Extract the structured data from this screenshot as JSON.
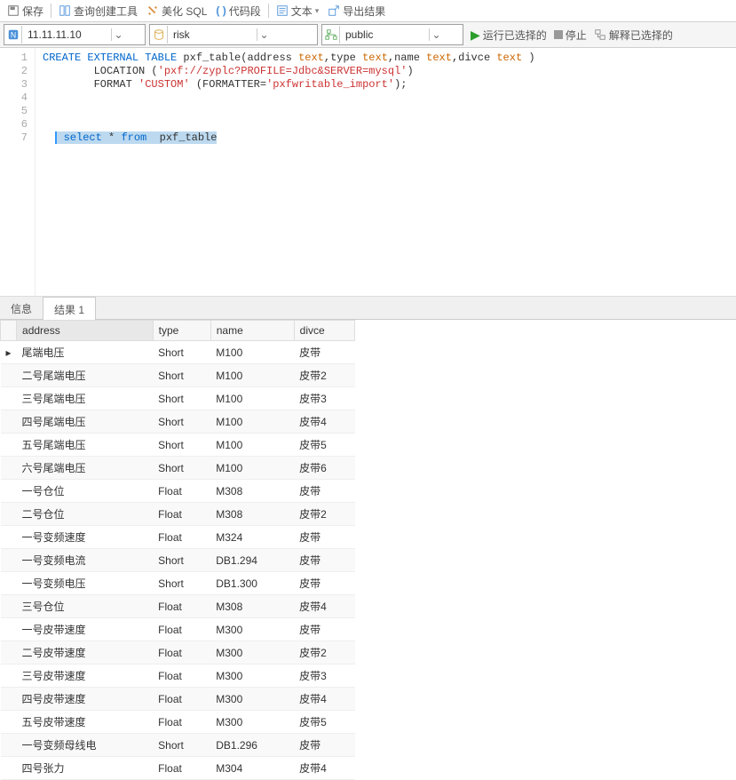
{
  "toolbar1": {
    "save": "保存",
    "queryBuilder": "查询创建工具",
    "beautifySql": "美化 SQL",
    "codeSnippet": "代码段",
    "text": "文本",
    "exportResult": "导出结果"
  },
  "toolbar2": {
    "host": "11.11.11.10",
    "database": "risk",
    "schema": "public",
    "run": "运行已选择的",
    "stop": "停止",
    "explain": "解释已选择的"
  },
  "editor": {
    "lines": [
      "1",
      "2",
      "3",
      "4",
      "5",
      "6",
      "7"
    ]
  },
  "sql": {
    "l1a": "CREATE EXTERNAL TABLE",
    "l1b": " pxf_table(address ",
    "l1c": "text",
    "l1d": ",type ",
    "l1e": "text",
    "l1f": ",name ",
    "l1g": "text",
    "l1h": ",divce ",
    "l1i": "text",
    "l1j": " )",
    "l2a": "        LOCATION (",
    "l2b": "'pxf://zyplc?PROFILE=Jdbc&SERVER=mysql'",
    "l2c": ")",
    "l3a": "        FORMAT ",
    "l3b": "'CUSTOM'",
    "l3c": " (FORMATTER=",
    "l3d": "'pxfwritable_import'",
    "l3e": ");",
    "l7a": " select",
    "l7b": " * ",
    "l7c": "from",
    "l7d": "  pxf_table"
  },
  "tabs": {
    "info": "信息",
    "result1": "结果 1"
  },
  "cols": {
    "c1": "address",
    "c2": "type",
    "c3": "name",
    "c4": "divce"
  },
  "rows": [
    {
      "address": "尾端电压",
      "type": "Short",
      "name": "M100",
      "divce": "皮带"
    },
    {
      "address": "二号尾端电压",
      "type": "Short",
      "name": "M100",
      "divce": "皮带2"
    },
    {
      "address": "三号尾端电压",
      "type": "Short",
      "name": "M100",
      "divce": "皮带3"
    },
    {
      "address": "四号尾端电压",
      "type": "Short",
      "name": "M100",
      "divce": "皮带4"
    },
    {
      "address": "五号尾端电压",
      "type": "Short",
      "name": "M100",
      "divce": "皮带5"
    },
    {
      "address": "六号尾端电压",
      "type": "Short",
      "name": "M100",
      "divce": "皮带6"
    },
    {
      "address": "一号仓位",
      "type": "Float",
      "name": "M308",
      "divce": "皮带"
    },
    {
      "address": "二号仓位",
      "type": "Float",
      "name": "M308",
      "divce": "皮带2"
    },
    {
      "address": "一号变频速度",
      "type": "Float",
      "name": "M324",
      "divce": "皮带"
    },
    {
      "address": "一号变频电流",
      "type": "Short",
      "name": "DB1.294",
      "divce": "皮带"
    },
    {
      "address": "一号变频电压",
      "type": "Short",
      "name": "DB1.300",
      "divce": "皮带"
    },
    {
      "address": "三号仓位",
      "type": "Float",
      "name": "M308",
      "divce": "皮带4"
    },
    {
      "address": "一号皮带速度",
      "type": "Float",
      "name": "M300",
      "divce": "皮带"
    },
    {
      "address": "二号皮带速度",
      "type": "Float",
      "name": "M300",
      "divce": "皮带2"
    },
    {
      "address": "三号皮带速度",
      "type": "Float",
      "name": "M300",
      "divce": "皮带3"
    },
    {
      "address": "四号皮带速度",
      "type": "Float",
      "name": "M300",
      "divce": "皮带4"
    },
    {
      "address": "五号皮带速度",
      "type": "Float",
      "name": "M300",
      "divce": "皮带5"
    },
    {
      "address": "一号变频母线电",
      "type": "Short",
      "name": "DB1.296",
      "divce": "皮带"
    },
    {
      "address": "四号张力",
      "type": "Float",
      "name": "M304",
      "divce": "皮带4"
    }
  ]
}
